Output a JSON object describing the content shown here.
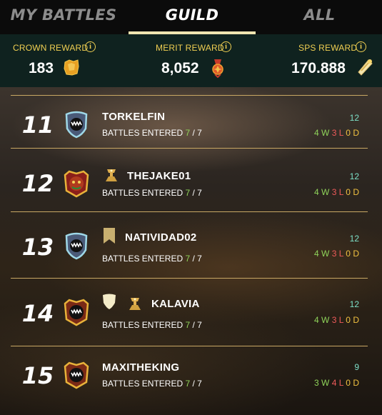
{
  "tabs": [
    {
      "label": "MY BATTLES",
      "active": false
    },
    {
      "label": "GUILD",
      "active": true
    },
    {
      "label": "ALL",
      "active": false
    }
  ],
  "rewards": [
    {
      "label": "CROWN REWARD",
      "value": "183",
      "icon": "crown-reward-icon"
    },
    {
      "label": "MERIT REWARD",
      "value": "8,052",
      "icon": "merit-reward-icon"
    },
    {
      "label": "SPS REWARD",
      "value": "170.888",
      "icon": "sps-reward-icon"
    }
  ],
  "info_glyph": "i",
  "rows": [
    {
      "rank": "11",
      "name": "TORKELFIN",
      "battles_label": "BATTLES ENTERED",
      "entered": "7",
      "total": "/ 7",
      "score": "12",
      "w": "4",
      "l": "3",
      "d": "0"
    },
    {
      "rank": "12",
      "name": "THEJAKE01",
      "battles_label": "BATTLES ENTERED",
      "entered": "7",
      "total": "/ 7",
      "score": "12",
      "w": "4",
      "l": "3",
      "d": "0"
    },
    {
      "rank": "13",
      "name": "NATIVIDAD02",
      "battles_label": "BATTLES ENTERED",
      "entered": "7",
      "total": "/ 7",
      "score": "12",
      "w": "4",
      "l": "3",
      "d": "0"
    },
    {
      "rank": "14",
      "name": "KALAVIA",
      "battles_label": "BATTLES ENTERED",
      "entered": "7",
      "total": "/ 7",
      "score": "12",
      "w": "4",
      "l": "3",
      "d": "0"
    },
    {
      "rank": "15",
      "name": "MAXITHEKING",
      "battles_label": "BATTLES ENTERED",
      "entered": "7",
      "total": "/ 7",
      "score": "9",
      "w": "3",
      "l": "4",
      "d": "0"
    }
  ],
  "wld_letters": {
    "w": "W",
    "l": "L",
    "d": "D"
  },
  "colors": {
    "accent": "#f0cf52",
    "win": "#8fd35a",
    "loss": "#ef5a5a",
    "draw": "#f0c040",
    "score": "#7de0c8"
  }
}
